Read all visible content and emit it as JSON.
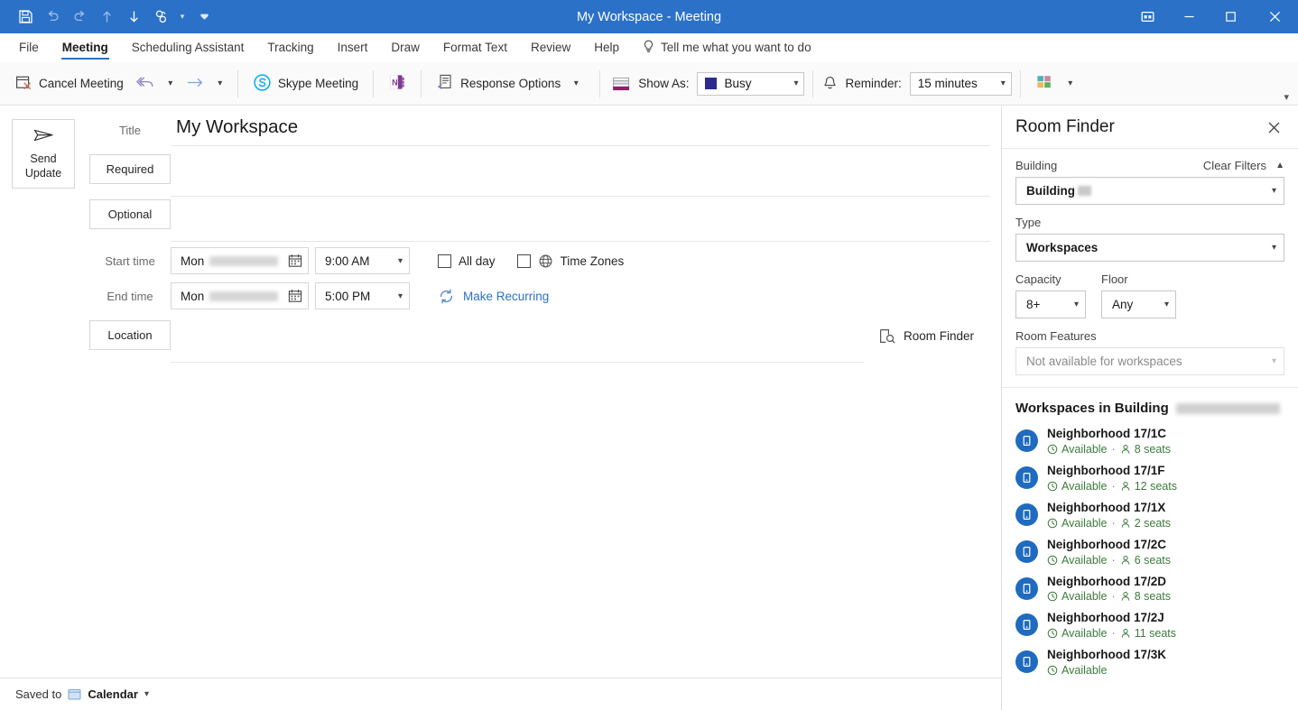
{
  "window": {
    "title": "My Workspace - Meeting",
    "quick_access": [
      {
        "name": "save-icon",
        "label": "Save"
      },
      {
        "name": "undo-icon",
        "label": "Undo"
      },
      {
        "name": "redo-icon",
        "label": "Redo"
      },
      {
        "name": "previous-item-icon",
        "label": "Previous Item"
      },
      {
        "name": "next-item-icon",
        "label": "Next Item"
      },
      {
        "name": "skype-icon",
        "label": "Skype"
      }
    ],
    "controls": [
      {
        "name": "ribbon-display-options",
        "label": "Ribbon Display Options"
      },
      {
        "name": "minimize",
        "label": "Minimize"
      },
      {
        "name": "maximize",
        "label": "Maximize"
      },
      {
        "name": "close",
        "label": "Close"
      }
    ]
  },
  "ribbon": {
    "tabs": [
      {
        "label": "File",
        "active": false
      },
      {
        "label": "Meeting",
        "active": true
      },
      {
        "label": "Scheduling Assistant",
        "active": false
      },
      {
        "label": "Tracking",
        "active": false
      },
      {
        "label": "Insert",
        "active": false
      },
      {
        "label": "Draw",
        "active": false
      },
      {
        "label": "Format Text",
        "active": false
      },
      {
        "label": "Review",
        "active": false
      },
      {
        "label": "Help",
        "active": false
      }
    ],
    "tell_me": "Tell me what you want to do",
    "cancel_meeting": "Cancel Meeting",
    "skype_meeting": "Skype Meeting",
    "meeting_notes": "Meeting Notes",
    "response_options": "Response Options",
    "show_as_label": "Show As:",
    "show_as_value": "Busy",
    "show_as_color": "#2c2c8f",
    "reminder_label": "Reminder:",
    "reminder_value": "15 minutes",
    "categorize": "Categorize"
  },
  "compose": {
    "send_update": "Send\nUpdate",
    "send_update_line1": "Send",
    "send_update_line2": "Update",
    "title_label": "Title",
    "title_value": "My Workspace",
    "required_label": "Required",
    "required_value": "",
    "optional_label": "Optional",
    "optional_value": "",
    "start_time_label": "Start time",
    "start_date_prefix": "Mon",
    "start_time_value": "9:00 AM",
    "end_time_label": "End time",
    "end_date_prefix": "Mon",
    "end_time_value": "5:00 PM",
    "all_day_label": "All day",
    "time_zones_label": "Time Zones",
    "make_recurring_label": "Make Recurring",
    "location_label": "Location",
    "location_value": "",
    "room_finder_link": "Room Finder"
  },
  "status": {
    "saved_to_prefix": "Saved to",
    "saved_to_value": "Calendar"
  },
  "room_finder": {
    "title": "Room Finder",
    "building_label": "Building",
    "clear_filters": "Clear Filters",
    "building_value": "Building",
    "type_label": "Type",
    "type_value": "Workspaces",
    "capacity_label": "Capacity",
    "capacity_value": "8+",
    "floor_label": "Floor",
    "floor_value": "Any",
    "room_features_label": "Room Features",
    "room_features_value": "Not available for workspaces",
    "list_heading": "Workspaces in Building",
    "status_color": "#3c7a3c",
    "avatar_color": "#1f6bc0",
    "rooms": [
      {
        "name": "Neighborhood 17/1C",
        "status": "Available",
        "seats": "8 seats"
      },
      {
        "name": "Neighborhood 17/1F",
        "status": "Available",
        "seats": "12 seats"
      },
      {
        "name": "Neighborhood 17/1X",
        "status": "Available",
        "seats": "2 seats"
      },
      {
        "name": "Neighborhood 17/2C",
        "status": "Available",
        "seats": "6 seats"
      },
      {
        "name": "Neighborhood 17/2D",
        "status": "Available",
        "seats": "8 seats"
      },
      {
        "name": "Neighborhood 17/2J",
        "status": "Available",
        "seats": "11 seats"
      },
      {
        "name": "Neighborhood 17/3K",
        "status": "Available",
        "seats": ""
      }
    ]
  }
}
